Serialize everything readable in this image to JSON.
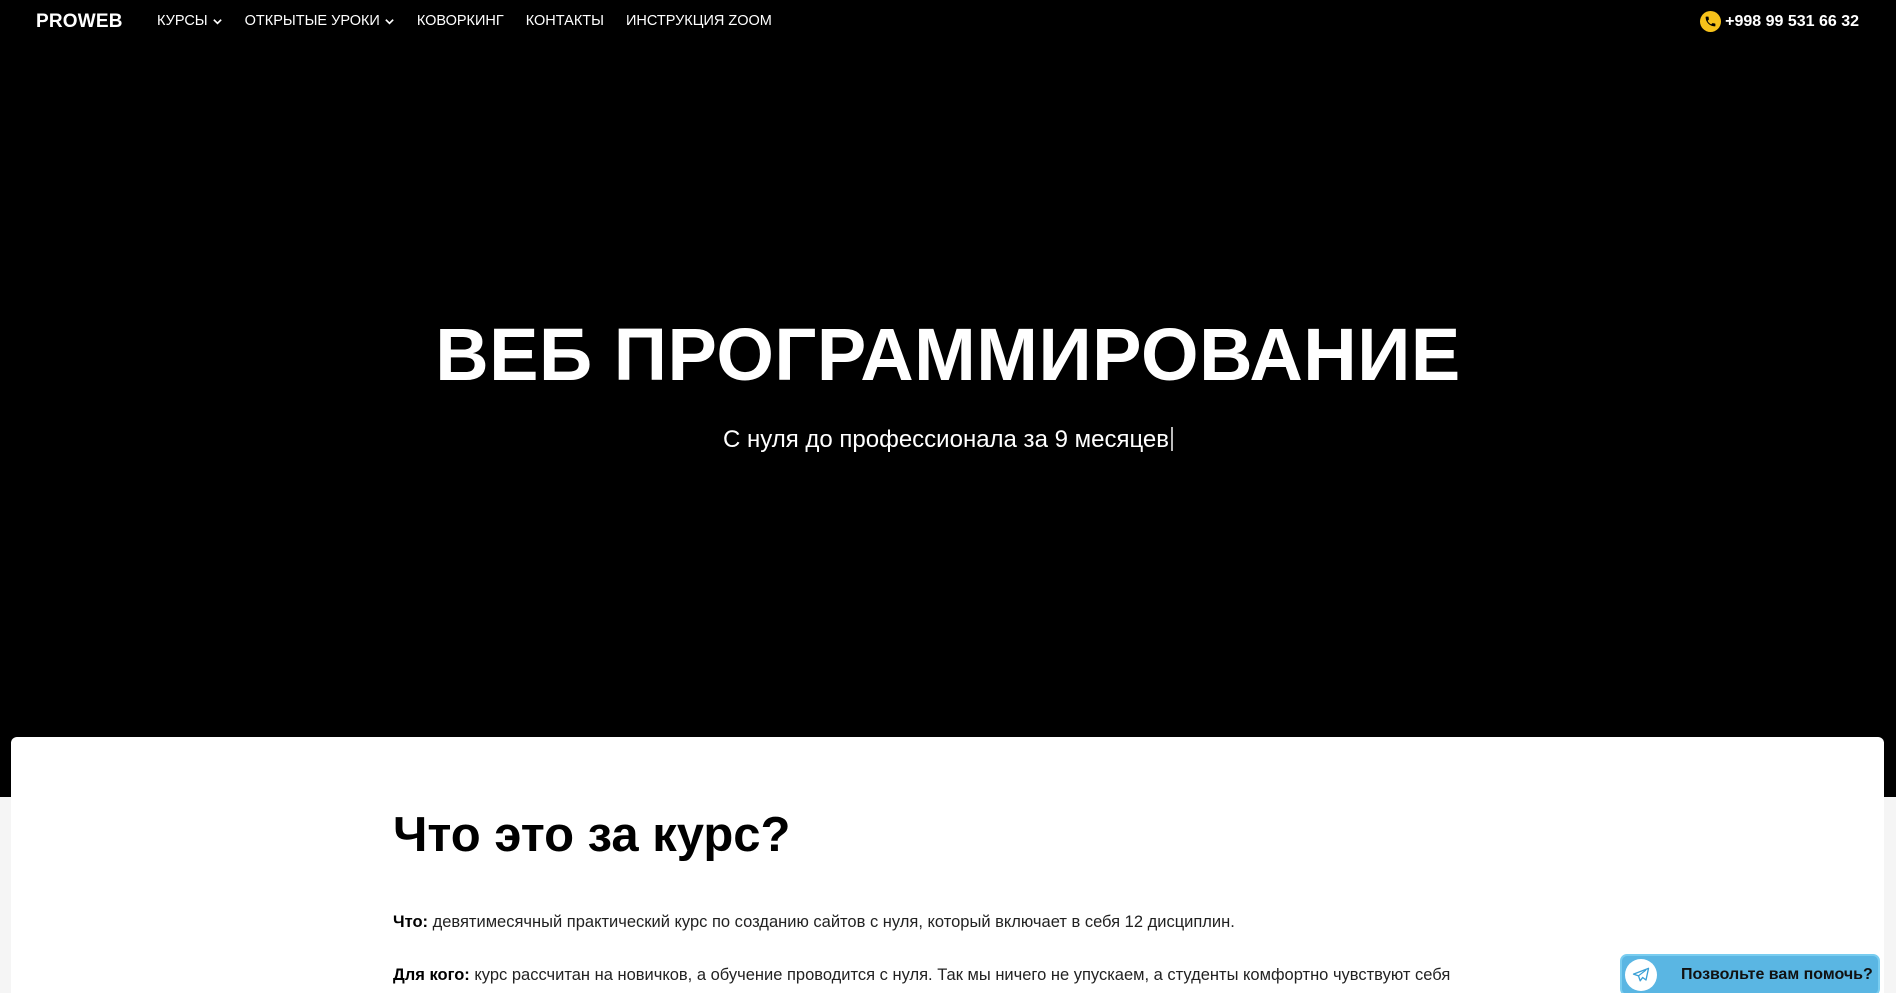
{
  "header": {
    "logo": "PROWEB",
    "nav": [
      {
        "label": "КУРСЫ",
        "dropdown": true
      },
      {
        "label": "ОТКРЫТЫЕ УРОКИ",
        "dropdown": true
      },
      {
        "label": "КОВОРКИНГ",
        "dropdown": false
      },
      {
        "label": "КОНТАКТЫ",
        "dropdown": false
      },
      {
        "label": "ИНСТРУКЦИЯ ZOOM",
        "dropdown": false
      }
    ],
    "phone": "+998 99 531 66 32",
    "phone_icon": "phone-icon"
  },
  "hero": {
    "title": "ВЕБ ПРОГРАММИРОВАНИЕ",
    "subtitle": "С нуля до профессионала за 9 месяцев"
  },
  "about": {
    "title": "Что это за курс?",
    "what_label": "Что:",
    "what_text": " девятимесячный практический курс по созданию сайтов с нуля, который включает в себя 12 дисциплин.",
    "who_label": "Для кого:",
    "who_text": " курс рассчитан на новичков, а обучение проводится с нуля. Так мы ничего не упускаем, а студенты комфортно чувствуют себя"
  },
  "help_widget": {
    "label": "Позвольте вам помочь?",
    "icon": "telegram-icon"
  },
  "colors": {
    "background": "#000000",
    "accent_yellow": "#f7c21a",
    "widget_blue": "#5ab6e3"
  }
}
